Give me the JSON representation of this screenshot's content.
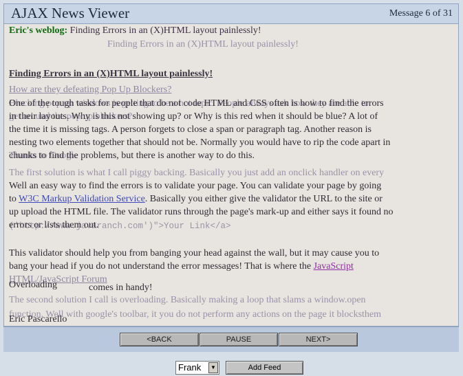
{
  "header": {
    "app_title": "AJAX News Viewer",
    "message_counter": "Message 6 of 31"
  },
  "content": {
    "blog_label": "Eric's weblog:",
    "blog_post_title": "Finding Errors in an (X)HTML layout painlessly!",
    "ghost_blog_title": "Finding Errors in an (X)HTML layout painlessly!",
    "article_heading": "Finding Errors in an (X)HTML layout painlessly!",
    "ghost_heading": "How are they defeating Pop Up Blockers?",
    "lines": [
      "One of the tough tasks for people that do not code HTML and CSS often is how to find the errors",
      "in their layouts. Why is this not showing up? or Why is this red when it should be blue? A lot of",
      "the time it is missing tags. A person forgets to close a span or paragraph tag. Another reason is",
      "nesting two elements together that should not be. Normally you would have to rip the code apart in",
      "chunks to find the problems, but there is another way to do this."
    ],
    "ghost_lines": [
      "Blocking pop up windows is getting to be a hot topic. People always ask how they are able to",
      "get around the pop up blockers?",
      "Thanks to Google",
      "The first solution is what I call piggy backing. Basically you just add an onclick handler on every"
    ],
    "para2_start": "Well an easy way to find the errors is to validate your page. You can validate your page by going",
    "para2_to": "to",
    "validator_link": "W3C Markup Validation Service",
    "para2_rest": ". Basically you either give the validator the URL to the site or",
    "para2_line3": "up upload the HTML file. The validator runs through the page's mark-up and either says it found no",
    "para2_line4": "errors or lists them out.",
    "code_line": "('http://www.javaranch.com')\">Your Link</a>",
    "para3_line1": "This validator should help you from banging your head against the wall, but it may cause you to",
    "para3_line2_a": "bang your head if you do not understand the error messages! That is where the",
    "forum_link": "JavaScript",
    "forum_link_ghost": "HTML/JavaScript Forum",
    "para3_comes": "comes in handy!",
    "ghost_overloading": "Overloading",
    "ghost_second": "The second solution I call is overloading. Basically making a loop that slams a window.open",
    "ghost_third": "function. Well with google's toolbar, it you do not perform any actions on the page it blocksthem",
    "signature": "Eric Pascarello"
  },
  "nav": {
    "back_label": "<BACK",
    "pause_label": "PAUSE",
    "next_label": "NEXT>"
  },
  "feed": {
    "selected": "Frank",
    "add_label": "Add Feed"
  }
}
